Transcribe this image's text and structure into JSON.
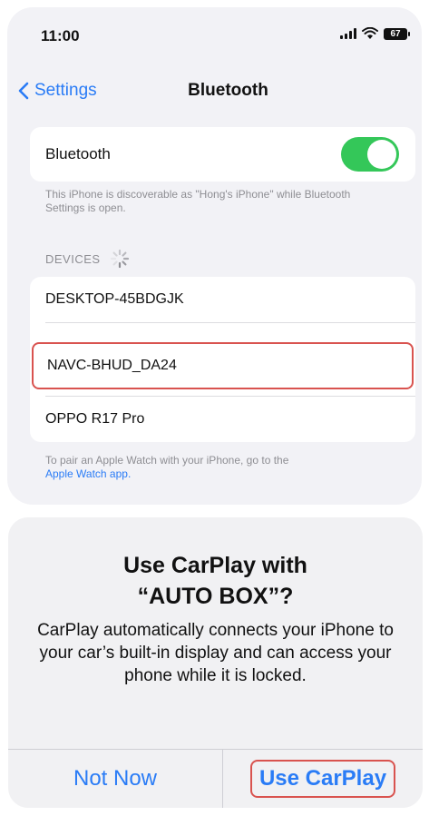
{
  "status_bar": {
    "time": "11:00",
    "battery": "67"
  },
  "nav": {
    "back_label": "Settings",
    "title": "Bluetooth"
  },
  "bluetooth": {
    "label": "Bluetooth",
    "enabled": true,
    "discoverable_note": "This iPhone is discoverable as \"Hong's iPhone\" while Bluetooth Settings is open."
  },
  "devices": {
    "header": "DEVICES",
    "items": [
      {
        "name": "DESKTOP-45BDGJK"
      },
      {
        "name": "NAVC-BHUD_DA24"
      },
      {
        "name": "OPPO R17 Pro"
      }
    ],
    "footer_text": "To pair an Apple Watch with your iPhone, go to the",
    "footer_link": "Apple Watch app."
  },
  "dialog": {
    "title_line1": "Use CarPlay with",
    "title_line2": "“AUTO BOX”?",
    "message": "CarPlay automatically connects your iPhone to your car’s built-in display and can access your phone while it is locked.",
    "cancel_label": "Not Now",
    "confirm_label": "Use CarPlay"
  },
  "colors": {
    "accent": "#2a7cf6",
    "toggle_on": "#34c759",
    "highlight": "#d9534f"
  }
}
